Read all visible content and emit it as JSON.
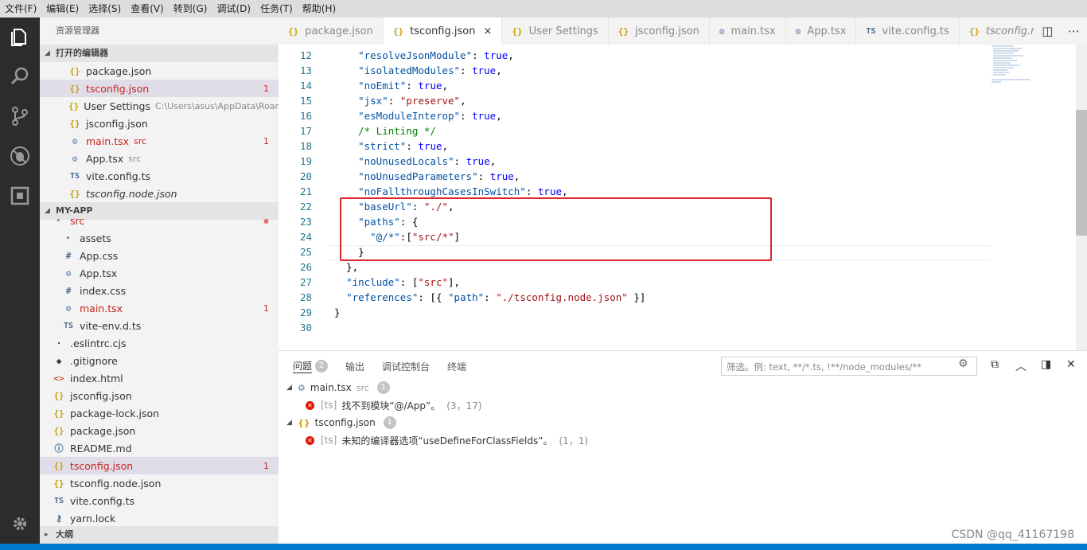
{
  "menu": [
    "文件(F)",
    "编辑(E)",
    "选择(S)",
    "查看(V)",
    "转到(G)",
    "调试(D)",
    "任务(T)",
    "帮助(H)"
  ],
  "sidebar": {
    "title": "资源管理器",
    "open_editors_header": "打开的编辑器",
    "open_editors": [
      {
        "icon": "{}",
        "type": "json",
        "name": "package.json"
      },
      {
        "icon": "{}",
        "type": "json",
        "name": "tsconfig.json",
        "badge": "1",
        "selected": true,
        "modified": true
      },
      {
        "icon": "{}",
        "type": "json",
        "name": "User Settings",
        "desc": "C:\\Users\\asus\\AppData\\Roam..."
      },
      {
        "icon": "{}",
        "type": "json",
        "name": "jsconfig.json"
      },
      {
        "icon": "⚙",
        "type": "gear",
        "name": "main.tsx",
        "desc": "src",
        "badge": "1",
        "error": true
      },
      {
        "icon": "⚙",
        "type": "gear",
        "name": "App.tsx",
        "desc": "src"
      },
      {
        "icon": "TS",
        "type": "ts",
        "name": "vite.config.ts"
      },
      {
        "icon": "{}",
        "type": "json",
        "name": "tsconfig.node.json",
        "italic": true
      }
    ],
    "project_header": "MY-APP",
    "project_files": [
      {
        "icon": "▸",
        "type": "folder",
        "name": "src",
        "indent": 1,
        "error": true,
        "dot": true
      },
      {
        "icon": "▸",
        "type": "folder",
        "name": "assets",
        "indent": 2
      },
      {
        "icon": "#",
        "type": "hash",
        "name": "App.css",
        "indent": 2
      },
      {
        "icon": "⚙",
        "type": "gear",
        "name": "App.tsx",
        "indent": 2
      },
      {
        "icon": "#",
        "type": "hash",
        "name": "index.css",
        "indent": 2
      },
      {
        "icon": "⚙",
        "type": "gear",
        "name": "main.tsx",
        "indent": 2,
        "badge": "1",
        "error": true
      },
      {
        "icon": "TS",
        "type": "ts",
        "name": "vite-env.d.ts",
        "indent": 2
      },
      {
        "icon": "·",
        "type": "git",
        "name": ".eslintrc.cjs",
        "indent": 1
      },
      {
        "icon": "◆",
        "type": "git",
        "name": ".gitignore",
        "indent": 1
      },
      {
        "icon": "<>",
        "type": "html",
        "name": "index.html",
        "indent": 1
      },
      {
        "icon": "{}",
        "type": "json",
        "name": "jsconfig.json",
        "indent": 1
      },
      {
        "icon": "{}",
        "type": "json",
        "name": "package-lock.json",
        "indent": 1
      },
      {
        "icon": "{}",
        "type": "json",
        "name": "package.json",
        "indent": 1
      },
      {
        "icon": "ⓘ",
        "type": "info",
        "name": "README.md",
        "indent": 1
      },
      {
        "icon": "{}",
        "type": "json",
        "name": "tsconfig.json",
        "indent": 1,
        "badge": "1",
        "selected": true,
        "error": true
      },
      {
        "icon": "{}",
        "type": "json",
        "name": "tsconfig.node.json",
        "indent": 1
      },
      {
        "icon": "TS",
        "type": "ts",
        "name": "vite.config.ts",
        "indent": 1
      },
      {
        "icon": "⚷",
        "type": "yarn",
        "name": "yarn.lock",
        "indent": 1
      }
    ],
    "outline_header": "大纲"
  },
  "tabs": [
    {
      "icon": "{}",
      "type": "json",
      "label": "package.json"
    },
    {
      "icon": "{}",
      "type": "json",
      "label": "tsconfig.json",
      "active": true,
      "close": "×"
    },
    {
      "icon": "{}",
      "type": "json",
      "label": "User Settings"
    },
    {
      "icon": "{}",
      "type": "json",
      "label": "jsconfig.json"
    },
    {
      "icon": "⚙",
      "type": "gear",
      "label": "main.tsx"
    },
    {
      "icon": "⚙",
      "type": "gear",
      "label": "App.tsx"
    },
    {
      "icon": "TS",
      "type": "ts",
      "label": "vite.config.ts"
    },
    {
      "icon": "{}",
      "type": "json",
      "label": "tsconfig.node.json",
      "italic": true
    }
  ],
  "code_lines": [
    {
      "n": "12",
      "html": "    <span class='key'>\"resolveJsonModule\"</span>: <span class='v'>true</span>,"
    },
    {
      "n": "13",
      "html": "    <span class='key'>\"isolatedModules\"</span>: <span class='v'>true</span>,"
    },
    {
      "n": "14",
      "html": "    <span class='key'>\"noEmit\"</span>: <span class='v'>true</span>,"
    },
    {
      "n": "15",
      "html": "    <span class='key'>\"jsx\"</span>: <span class='s'>\"preserve\"</span>,"
    },
    {
      "n": "16",
      "html": "    <span class='key'>\"esModuleInterop\"</span>: <span class='v'>true</span>,"
    },
    {
      "n": "17",
      "html": "    <span class='c'>/* Linting */</span>"
    },
    {
      "n": "18",
      "html": "    <span class='key'>\"strict\"</span>: <span class='v'>true</span>,"
    },
    {
      "n": "19",
      "html": "    <span class='key'>\"noUnusedLocals\"</span>: <span class='v'>true</span>,"
    },
    {
      "n": "20",
      "html": "    <span class='key'>\"noUnusedParameters\"</span>: <span class='v'>true</span>,"
    },
    {
      "n": "21",
      "html": "    <span class='key'>\"noFallthroughCasesInSwitch\"</span>: <span class='v'>true</span>,"
    },
    {
      "n": "22",
      "html": "    <span class='key'>\"baseUrl\"</span>: <span class='s'>\"./\"</span>,"
    },
    {
      "n": "23",
      "html": "    <span class='key'>\"paths\"</span>: {"
    },
    {
      "n": "24",
      "html": "      <span class='key'>\"@/*\"</span>:[<span class='s'>\"src/*\"</span>]"
    },
    {
      "n": "25",
      "html": "    }"
    },
    {
      "n": "26",
      "html": "  },"
    },
    {
      "n": "27",
      "html": "  <span class='key'>\"include\"</span>: [<span class='s'>\"src\"</span>],"
    },
    {
      "n": "28",
      "html": "  <span class='key'>\"references\"</span>: [{ <span class='key'>\"path\"</span>: <span class='s'>\"./tsconfig.node.json\"</span> }]"
    },
    {
      "n": "29",
      "html": "}"
    },
    {
      "n": "30",
      "html": ""
    }
  ],
  "panel": {
    "tabs": [
      {
        "label": "问题",
        "badge": "2",
        "active": true
      },
      {
        "label": "输出"
      },
      {
        "label": "调试控制台"
      },
      {
        "label": "终端"
      }
    ],
    "filter_placeholder": "筛选。例: text, **/*.ts, !**/node_modules/**",
    "groups": [
      {
        "file": "main.tsx",
        "icon": "⚙",
        "path": "src",
        "count": "1",
        "items": [
          {
            "source": "[ts]",
            "msg": "找不到模块“@/App”。",
            "loc": "(3，17)"
          }
        ]
      },
      {
        "file": "tsconfig.json",
        "icon": "{}",
        "path": "",
        "count": "1",
        "items": [
          {
            "source": "[ts]",
            "msg": "未知的编译器选项“useDefineForClassFields”。",
            "loc": "(1，1)"
          }
        ]
      }
    ]
  },
  "watermark": "CSDN @qq_41167198",
  "colors": {
    "accent": "#007acc",
    "error": "#e51400",
    "highlight_box": "#e0242b"
  }
}
